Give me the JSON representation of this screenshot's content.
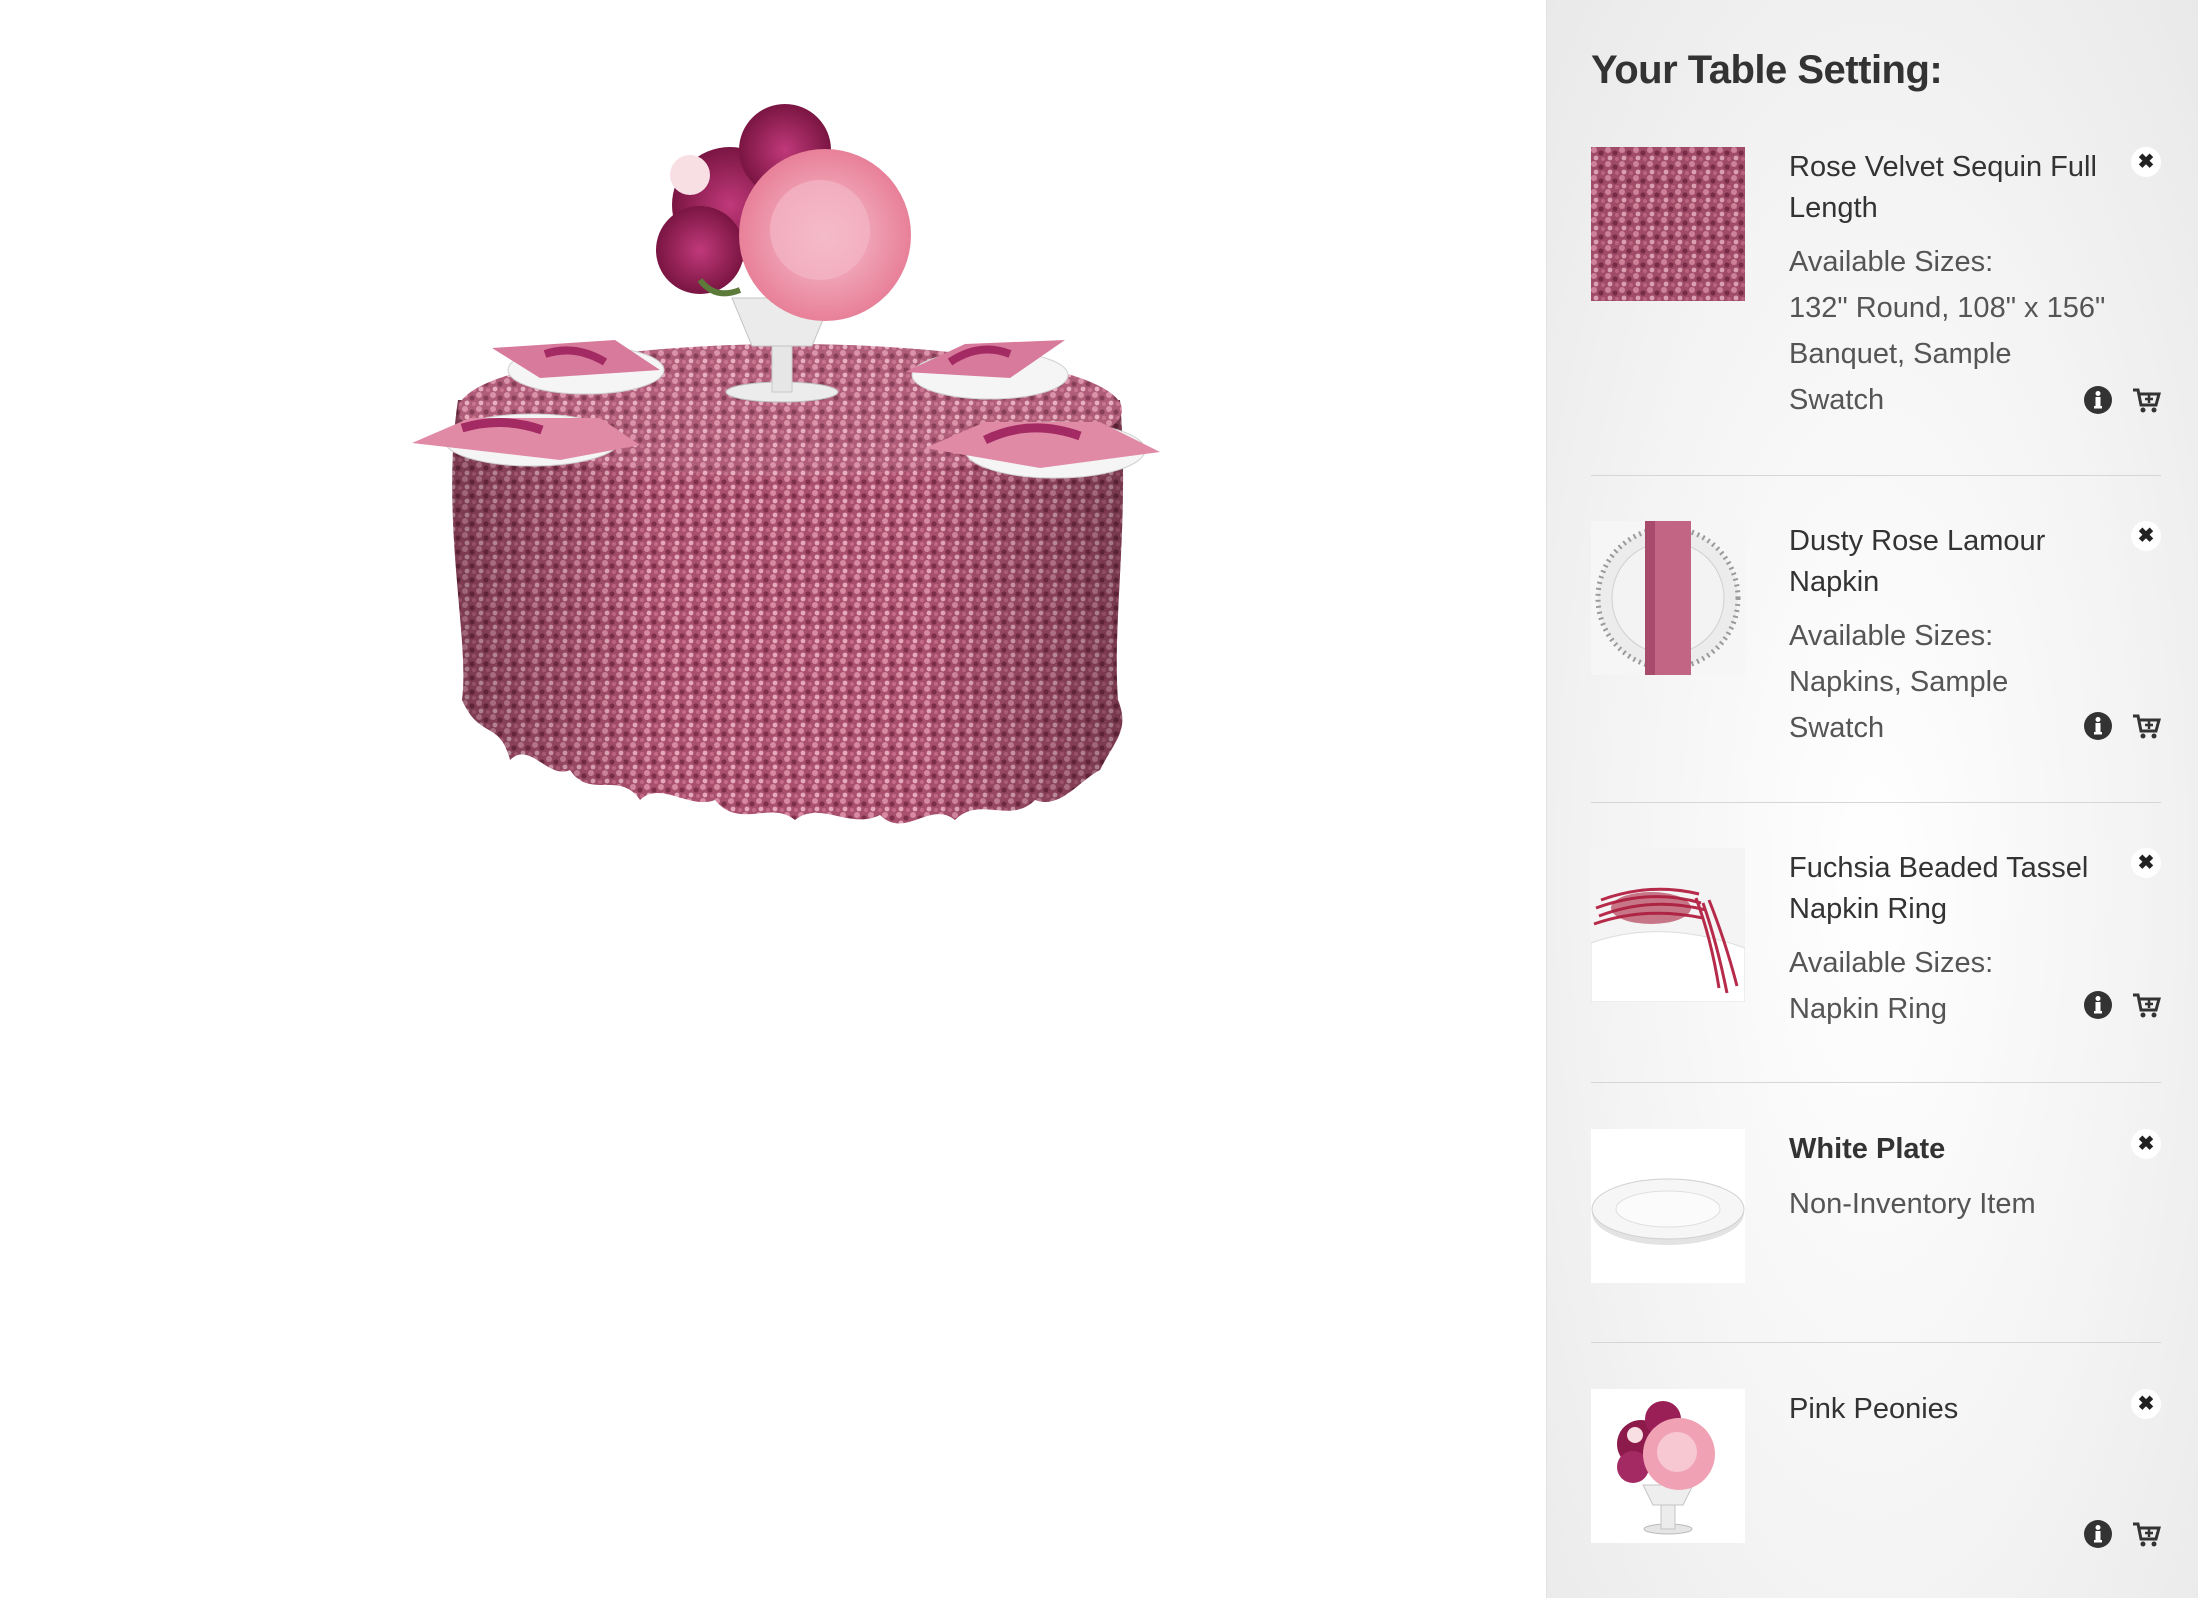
{
  "sidebar": {
    "title": "Your Table Setting:",
    "items": [
      {
        "name": "Rose Velvet Sequin Full Length",
        "sizes_label": "Available Sizes:",
        "sizes": "132\" Round, 108\" x 156\" Banquet, Sample Swatch"
      },
      {
        "name": "Dusty Rose Lamour Napkin",
        "sizes_label": "Available Sizes:",
        "sizes": "Napkins, Sample Swatch"
      },
      {
        "name": "Fuchsia Beaded Tassel Napkin Ring",
        "sizes_label": "Available Sizes:",
        "sizes": "Napkin Ring"
      },
      {
        "name": "White Plate",
        "note": "Non-Inventory Item"
      },
      {
        "name": "Pink Peonies"
      }
    ]
  },
  "icons": {
    "remove": "close-icon",
    "info": "info-icon",
    "cart": "add-to-cart-icon"
  },
  "colors": {
    "sequin": "#b05a76",
    "napkin": "#c9728f",
    "peony_light": "#f2a4b3",
    "peony_dark": "#9a1f56"
  }
}
